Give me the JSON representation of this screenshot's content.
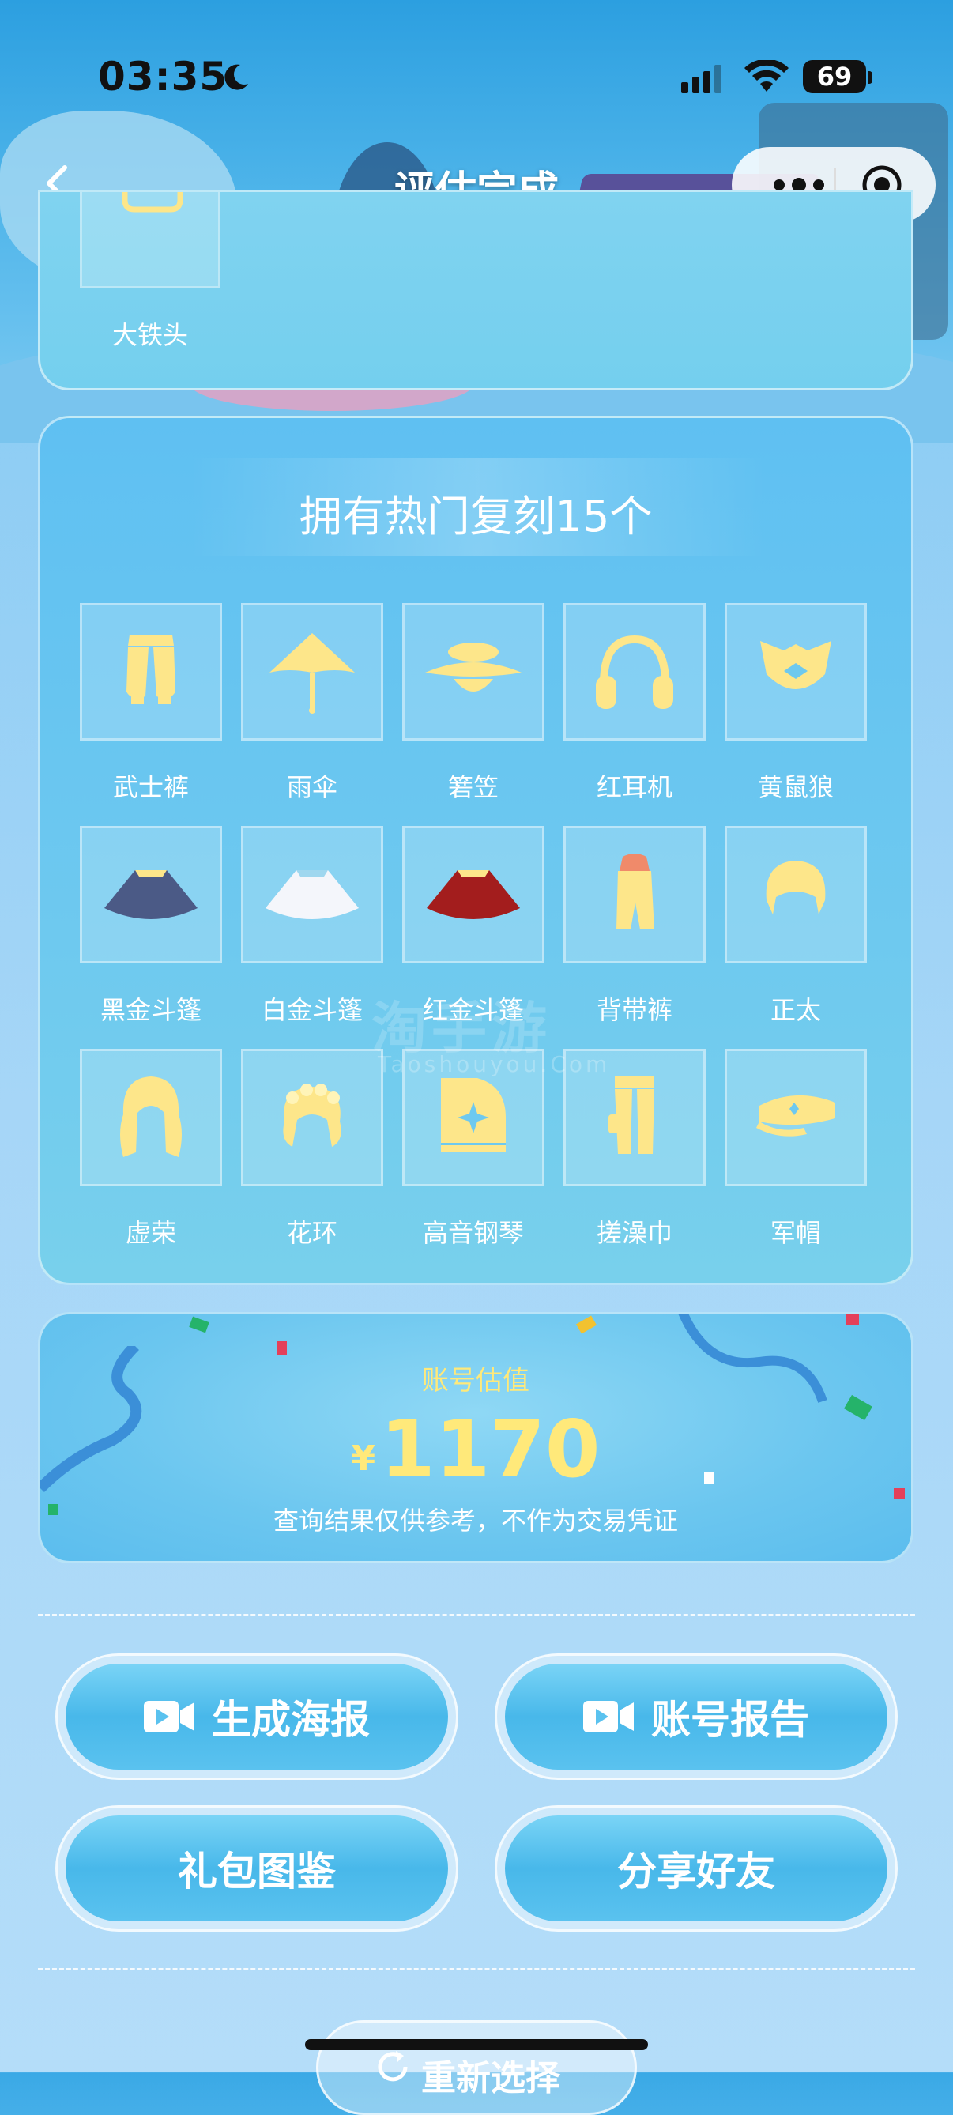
{
  "status_bar": {
    "time": "03:35",
    "battery": "69"
  },
  "nav": {
    "title": "评估完成"
  },
  "top_card": {
    "item_label": "大铁头"
  },
  "popular": {
    "heading": "拥有热门复刻15个",
    "items": [
      {
        "label": "武士裤",
        "icon": "samurai-pants-icon"
      },
      {
        "label": "雨伞",
        "icon": "umbrella-icon"
      },
      {
        "label": "箬笠",
        "icon": "bamboo-hat-icon"
      },
      {
        "label": "红耳机",
        "icon": "headphones-icon"
      },
      {
        "label": "黄鼠狼",
        "icon": "weasel-mask-icon"
      },
      {
        "label": "黑金斗篷",
        "icon": "black-gold-cape-icon"
      },
      {
        "label": "白金斗篷",
        "icon": "white-gold-cape-icon"
      },
      {
        "label": "红金斗篷",
        "icon": "red-gold-cape-icon"
      },
      {
        "label": "背带裤",
        "icon": "overalls-icon"
      },
      {
        "label": "正太",
        "icon": "short-hair-icon"
      },
      {
        "label": "虚荣",
        "icon": "long-wavy-hair-icon"
      },
      {
        "label": "花环",
        "icon": "flower-wreath-hair-icon"
      },
      {
        "label": "高音钢琴",
        "icon": "piano-icon"
      },
      {
        "label": "搓澡巾",
        "icon": "bath-towel-pants-icon"
      },
      {
        "label": "军帽",
        "icon": "military-cap-icon"
      }
    ]
  },
  "watermark": {
    "main": "淘手游",
    "sub": "Taoshouyou.Com"
  },
  "valuation": {
    "label": "账号估值",
    "currency": "¥",
    "amount": "1170",
    "note": "查询结果仅供参考，不作为交易凭证"
  },
  "buttons": {
    "poster": "生成海报",
    "report": "账号报告",
    "gift_catalog": "礼包图鉴",
    "share": "分享好友",
    "reselect": "重新选择"
  },
  "colors": {
    "accent_yellow": "#ffe97a",
    "item_yellow": "#fde68a",
    "card_blue": "#6ec9ef"
  }
}
